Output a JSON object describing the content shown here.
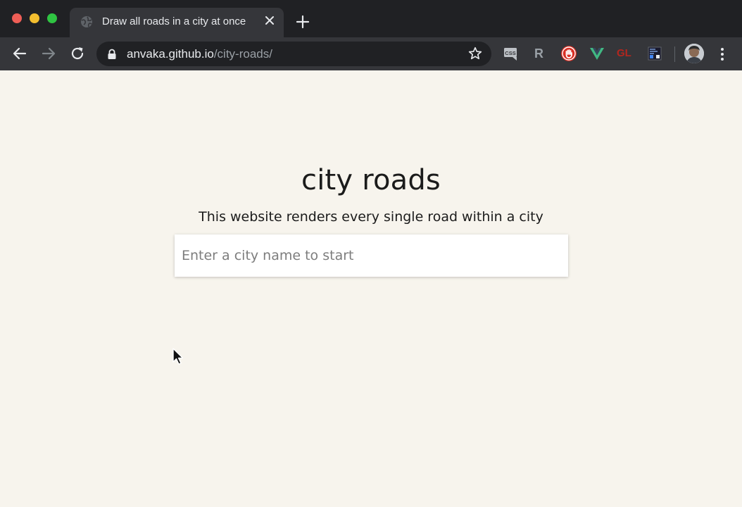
{
  "browser": {
    "tab": {
      "title": "Draw all roads in a city at once",
      "icon": "globe-icon"
    },
    "address_bar": {
      "host": "anvaka.github.io",
      "path": "/city-roads/",
      "secure": true
    },
    "extensions": [
      {
        "name": "css-viewer-extension-icon",
        "label": "CSS"
      },
      {
        "name": "r-extension-icon",
        "label": "R"
      },
      {
        "name": "hand-stop-extension-icon",
        "label": ""
      },
      {
        "name": "vue-devtools-extension-icon",
        "label": ""
      },
      {
        "name": "gl-extension-icon",
        "label": "GL"
      },
      {
        "name": "screenshot-extension-icon",
        "label": ""
      }
    ],
    "colors": {
      "titlebar": "#202124",
      "toolbar": "#35363a",
      "page_background": "#f7f4ed"
    }
  },
  "page": {
    "title": "city roads",
    "subtitle": "This website renders every single road within a city",
    "search": {
      "placeholder": "Enter a city name to start",
      "value": ""
    }
  }
}
